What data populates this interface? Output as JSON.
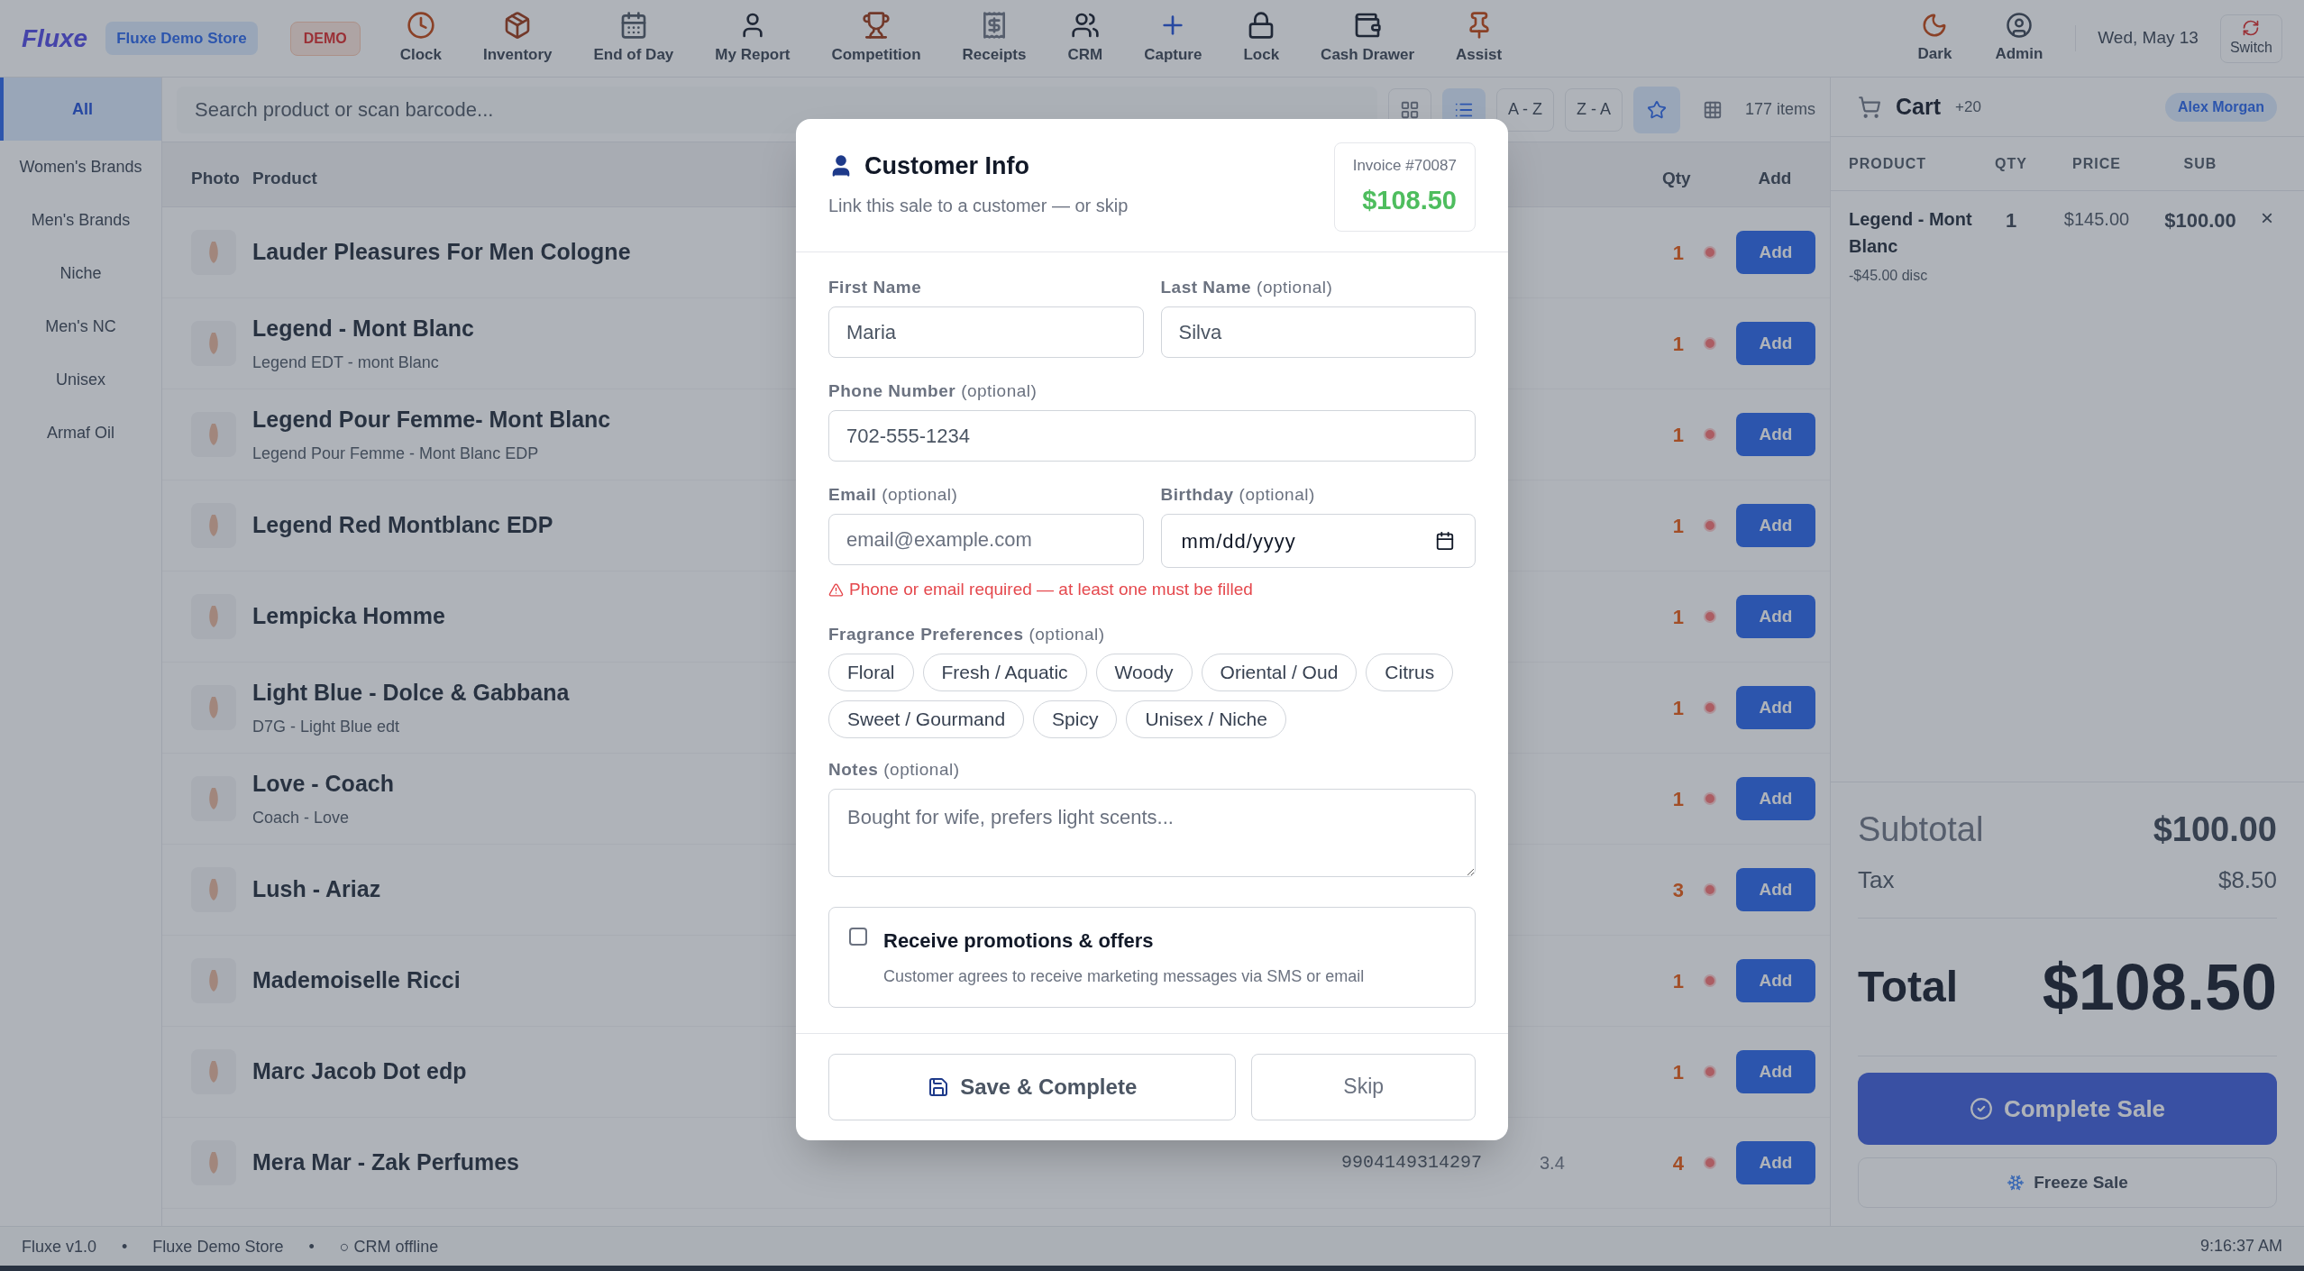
{
  "top_bar": {
    "logo": "Fluxe",
    "store": "Fluxe Demo Store",
    "badge": "DEMO",
    "nav": [
      {
        "label": "Clock"
      },
      {
        "label": "Inventory"
      },
      {
        "label": "End of Day"
      },
      {
        "label": "My Report"
      },
      {
        "label": "Competition"
      },
      {
        "label": "Receipts"
      },
      {
        "label": "CRM"
      },
      {
        "label": "Capture"
      },
      {
        "label": "Lock"
      },
      {
        "label": "Cash Drawer"
      },
      {
        "label": "Assist"
      }
    ],
    "right": [
      {
        "label": "Dark"
      },
      {
        "label": "Admin"
      }
    ],
    "date": "Wed, May 13",
    "switch": "Switch"
  },
  "sidebar": {
    "items": [
      {
        "label": "All",
        "selected": true
      },
      {
        "label": "Women's Brands",
        "selected": false
      },
      {
        "label": "Men's Brands",
        "selected": false
      },
      {
        "label": "Niche",
        "selected": false
      },
      {
        "label": "Men's NC",
        "selected": false
      },
      {
        "label": "Unisex",
        "selected": false
      },
      {
        "label": "Armaf Oil",
        "selected": false
      }
    ]
  },
  "toolbar": {
    "search_placeholder": "Search product or scan barcode...",
    "sort_buttons": [
      {
        "label": "A - Z",
        "selected": false
      },
      {
        "label": "Z - A",
        "selected": false
      }
    ],
    "count": "177 items"
  },
  "table": {
    "columns": [
      "Photo",
      "Product",
      "Qty",
      "Add"
    ],
    "rows": [
      {
        "name": "Lauder Pleasures For Men Cologne",
        "qty": "1",
        "add": "Add"
      },
      {
        "name": "Legend - Mont Blanc",
        "sub": "Legend EDT - mont Blanc",
        "qty": "1",
        "add": "Add"
      },
      {
        "name": "Legend Pour Femme- Mont Blanc",
        "sub": "Legend Pour Femme - Mont Blanc EDP",
        "qty": "1",
        "add": "Add"
      },
      {
        "name": "Legend Red Montblanc EDP",
        "qty": "1",
        "add": "Add"
      },
      {
        "name": "Lempicka Homme",
        "qty": "1",
        "add": "Add"
      },
      {
        "name": "Light Blue - Dolce & Gabbana",
        "sub": "D7G - Light Blue edt",
        "qty": "1",
        "add": "Add"
      },
      {
        "name": "Love - Coach",
        "sub": "Coach - Love",
        "qty": "1",
        "add": "Add"
      },
      {
        "name": "Lush - Ariaz",
        "qty": "3",
        "add": "Add"
      },
      {
        "name": "Mademoiselle Ricci",
        "qty": "1",
        "add": "Add"
      },
      {
        "name": "Marc Jacob Dot edp",
        "qty": "1",
        "add": "Add"
      },
      {
        "name": "Mera Mar - Zak Perfumes",
        "barcode": "9904149314297",
        "size": "3.4",
        "qty": "4",
        "add": "Add"
      }
    ]
  },
  "cart": {
    "title": "Cart",
    "count": "+20",
    "customer": "Alex Morgan",
    "columns": [
      "PRODUCT",
      "QTY",
      "PRICE",
      "SUB"
    ],
    "items": [
      {
        "name": "Legend - Mont Blanc",
        "discount": "-$45.00 disc",
        "qty": "1",
        "price": "$145.00",
        "sub": "$100.00",
        "remove": "×"
      }
    ],
    "subtotal_label": "Subtotal",
    "subtotal": "$100.00",
    "tax_label": "Tax",
    "tax": "$8.50",
    "total_label": "Total",
    "total": "$108.50",
    "complete": "Complete Sale",
    "freeze": "Freeze Sale"
  },
  "status_bar": {
    "items": [
      "Fluxe v1.0",
      "•",
      "Fluxe Demo Store",
      "•",
      "○ CRM offline"
    ],
    "time": "9:16:37 AM"
  },
  "dialog": {
    "title": "Customer Info",
    "subtitle": "Link this sale to a customer — or skip",
    "invoice": "Invoice #70087",
    "amount": "$108.50",
    "first_name": {
      "label": "First Name",
      "value": "Maria"
    },
    "last_name": {
      "label": "Last Name",
      "hint": "(optional)",
      "value": "Silva"
    },
    "phone": {
      "label": "Phone Number",
      "hint": "(optional)",
      "value": "702-555-1234"
    },
    "email": {
      "label": "Email",
      "hint": "(optional)",
      "placeholder": "email@example.com"
    },
    "birthday": {
      "label": "Birthday",
      "hint": "(optional)",
      "value": "mm/dd/yyyy"
    },
    "error": "Phone or email required — at least one must be filled",
    "preferences": {
      "label": "Fragrance Preferences",
      "hint": "(optional)",
      "options": [
        {
          "label": "Floral",
          "selected": false
        },
        {
          "label": "Fresh / Aquatic",
          "selected": false
        },
        {
          "label": "Woody",
          "selected": false
        },
        {
          "label": "Oriental / Oud",
          "selected": false
        },
        {
          "label": "Citrus",
          "selected": false
        },
        {
          "label": "Sweet / Gourmand",
          "selected": false
        },
        {
          "label": "Spicy",
          "selected": false
        },
        {
          "label": "Unisex / Niche",
          "selected": false
        }
      ]
    },
    "notes": {
      "label": "Notes",
      "hint": "(optional)",
      "placeholder": "Bought for wife, prefers light scents..."
    },
    "promotions": {
      "label": "Receive promotions & offers",
      "description": "Customer agrees to receive marketing messages via SMS or email",
      "checked": false
    },
    "buttons": {
      "save": "Save & Complete",
      "skip": "Skip"
    }
  }
}
